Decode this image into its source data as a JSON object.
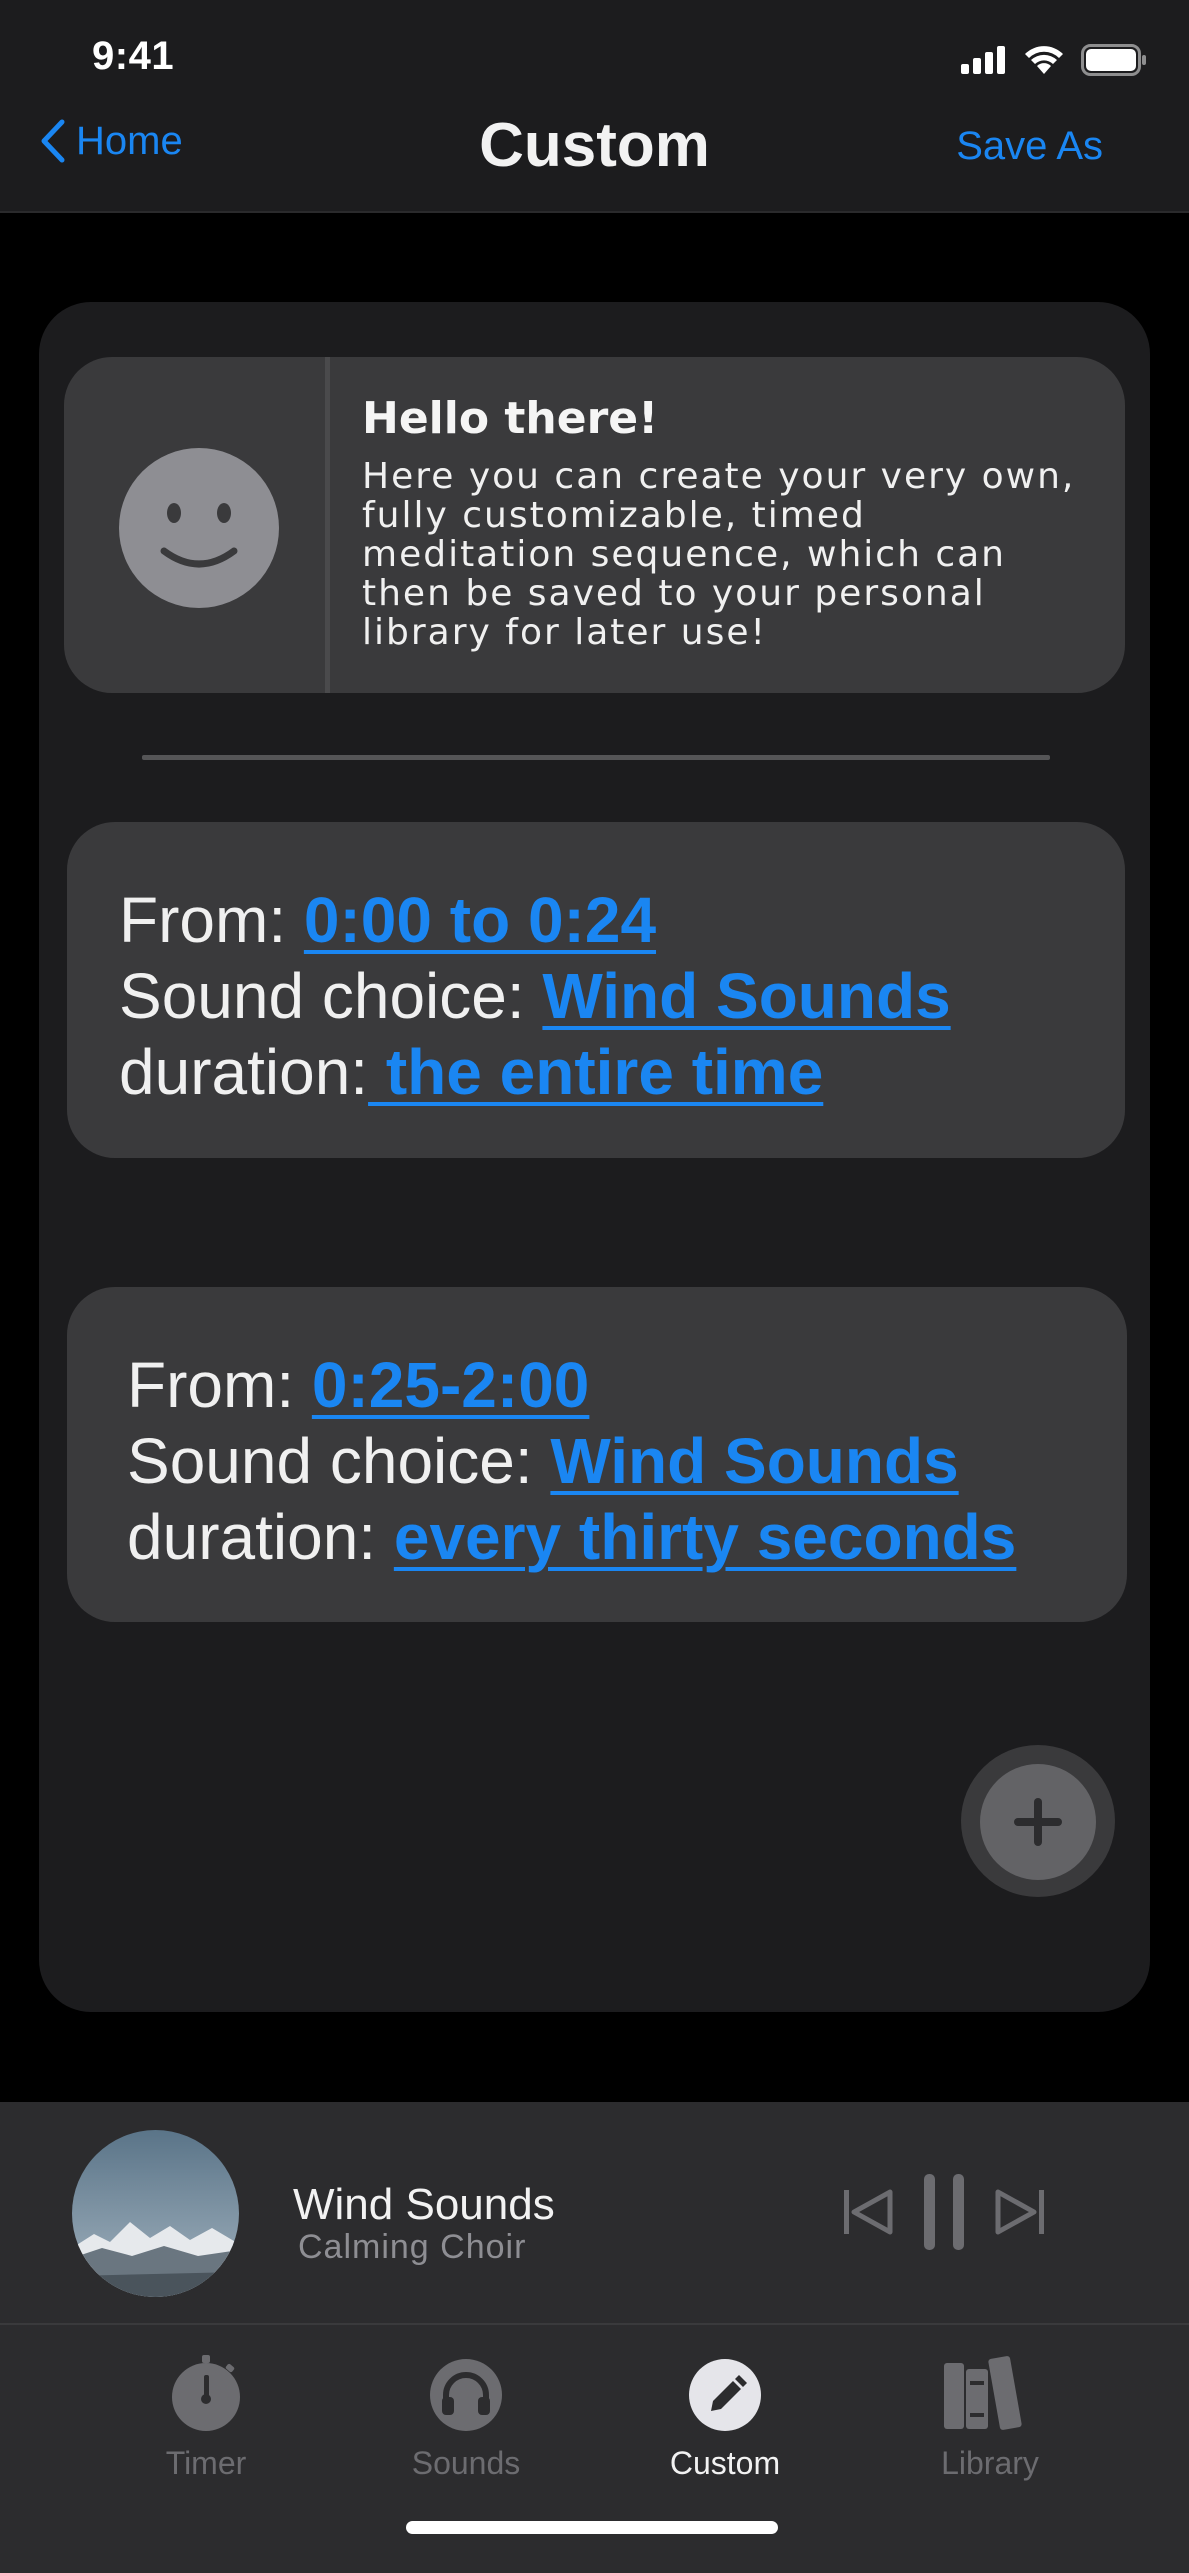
{
  "status_bar": {
    "time": "9:41"
  },
  "nav": {
    "back_label": "Home",
    "title": "Custom",
    "action_label": "Save As"
  },
  "intro": {
    "title": "Hello there!",
    "text": "Here you can create your very own, fully customizable, timed meditation sequence, which can then be saved to your personal library for later use!"
  },
  "segments": [
    {
      "from_label": "From: ",
      "from_value": "0:00 to 0:24",
      "sound_label": "Sound choice: ",
      "sound_value": "Wind Sounds",
      "duration_label": "duration:",
      "duration_value": " the entire time"
    },
    {
      "from_label": "From: ",
      "from_value": "0:25-2:00",
      "sound_label": "Sound choice: ",
      "sound_value": "Wind Sounds",
      "duration_label": "duration: ",
      "duration_value": "every thirty seconds"
    }
  ],
  "player": {
    "title": "Wind Sounds",
    "subtitle": "Calming Choir"
  },
  "tabs": [
    {
      "label": "Timer",
      "icon": "stopwatch-icon"
    },
    {
      "label": "Sounds",
      "icon": "headphones-icon"
    },
    {
      "label": "Custom",
      "icon": "pencil-icon",
      "active": true
    },
    {
      "label": "Library",
      "icon": "books-icon"
    }
  ],
  "colors": {
    "accent": "#1a86f2",
    "background": "#000000",
    "panel": "#1c1c1e",
    "card": "#3a3a3c"
  }
}
